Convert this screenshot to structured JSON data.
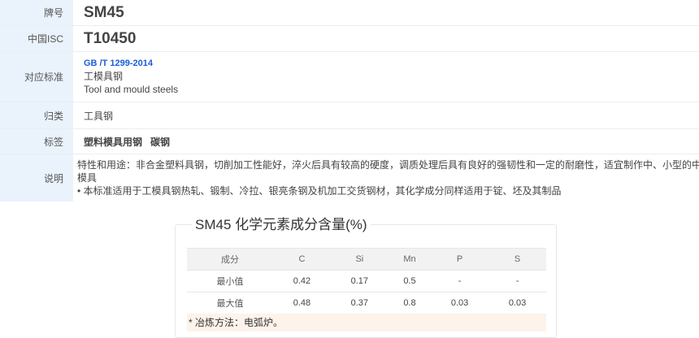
{
  "info": {
    "grade": {
      "label": "牌号",
      "value": "SM45"
    },
    "isc": {
      "label": "中国ISC",
      "value": "T10450"
    },
    "standard": {
      "label": "对应标准",
      "code": "GB /T 1299-2014",
      "name_cn": "工模具钢",
      "name_en": "Tool and mould steels"
    },
    "category": {
      "label": "归类",
      "value": "工具钢"
    },
    "tags": {
      "label": "标签",
      "items": [
        "塑料模具用钢",
        "碳钢"
      ]
    },
    "description": {
      "label": "说明",
      "line1": "特性和用途：非合金塑料具钢，切削加工性能好，淬火后具有较高的硬度，调质处理后具有良好的强韧性和一定的耐磨性，适宜制作中、小型的中、低档次的塑料",
      "line2": "模具",
      "line3": "• 本标准适用于工模具钢热轧、锻制、冷拉、银亮条钢及机加工交货钢材，其化学成分同样适用于锭、坯及其制品"
    }
  },
  "composition": {
    "title": "SM45 化学元素成分含量(%)",
    "header": [
      "成分",
      "C",
      "Si",
      "Mn",
      "P",
      "S"
    ],
    "rows": [
      [
        "最小值",
        "0.42",
        "0.17",
        "0.5",
        "-",
        "-"
      ],
      [
        "最大值",
        "0.48",
        "0.37",
        "0.8",
        "0.03",
        "0.03"
      ]
    ],
    "note": "* 冶炼方法：电弧炉。"
  }
}
